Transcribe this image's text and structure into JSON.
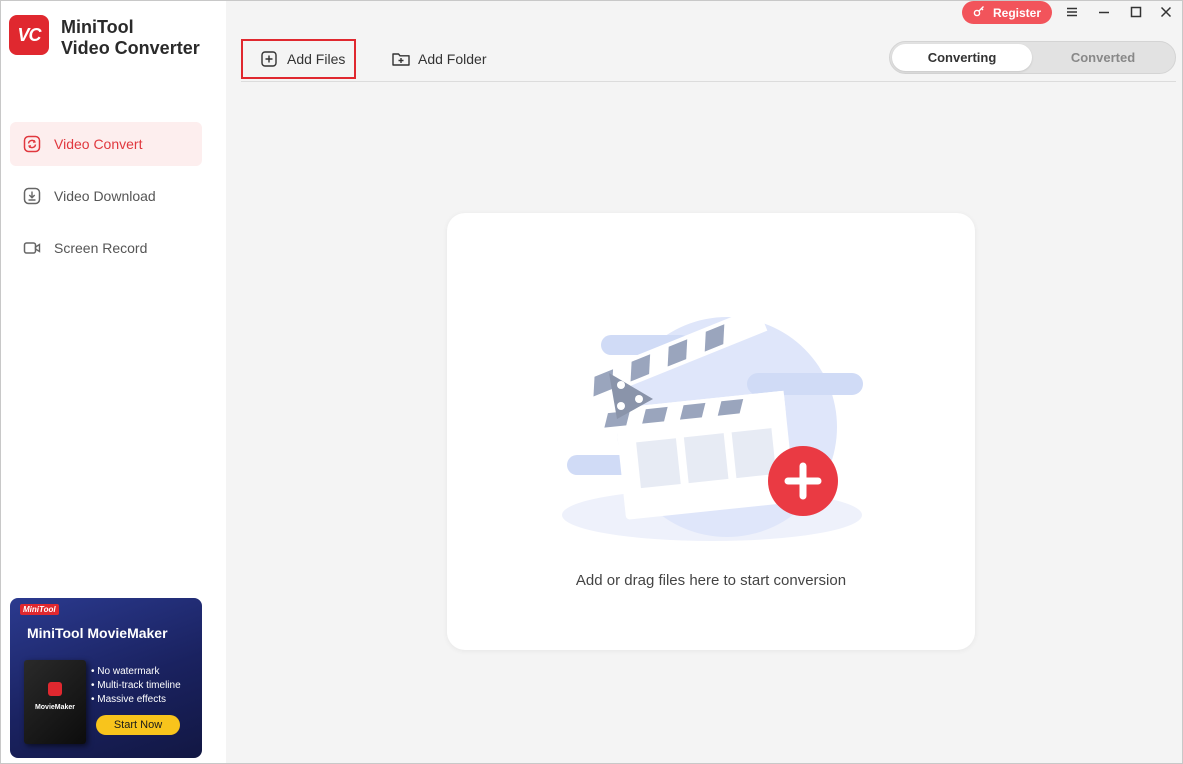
{
  "app": {
    "logo_text": "VC",
    "name_line1": "MiniTool",
    "name_line2": "Video Converter"
  },
  "sidebar": {
    "items": [
      {
        "label": "Video Convert",
        "icon": "refresh-icon",
        "active": true
      },
      {
        "label": "Video Download",
        "icon": "download-icon",
        "active": false
      },
      {
        "label": "Screen Record",
        "icon": "camera-icon",
        "active": false
      }
    ]
  },
  "promo": {
    "brand": "MiniTool",
    "title": "MiniTool MovieMaker",
    "box_name": "MovieMaker",
    "features": [
      "• No watermark",
      "• Multi-track timeline",
      "• Massive effects"
    ],
    "cta": "Start Now"
  },
  "header": {
    "register_label": "Register"
  },
  "toolbar": {
    "add_files_label": "Add Files",
    "add_folder_label": "Add Folder"
  },
  "tabs": {
    "converting": "Converting",
    "converted": "Converted",
    "active": "converting"
  },
  "dropzone": {
    "text": "Add or drag files here to start conversion"
  },
  "colors": {
    "accent": "#e0282f",
    "register_bg": "#f2545b",
    "promo_cta": "#f8c41c"
  }
}
